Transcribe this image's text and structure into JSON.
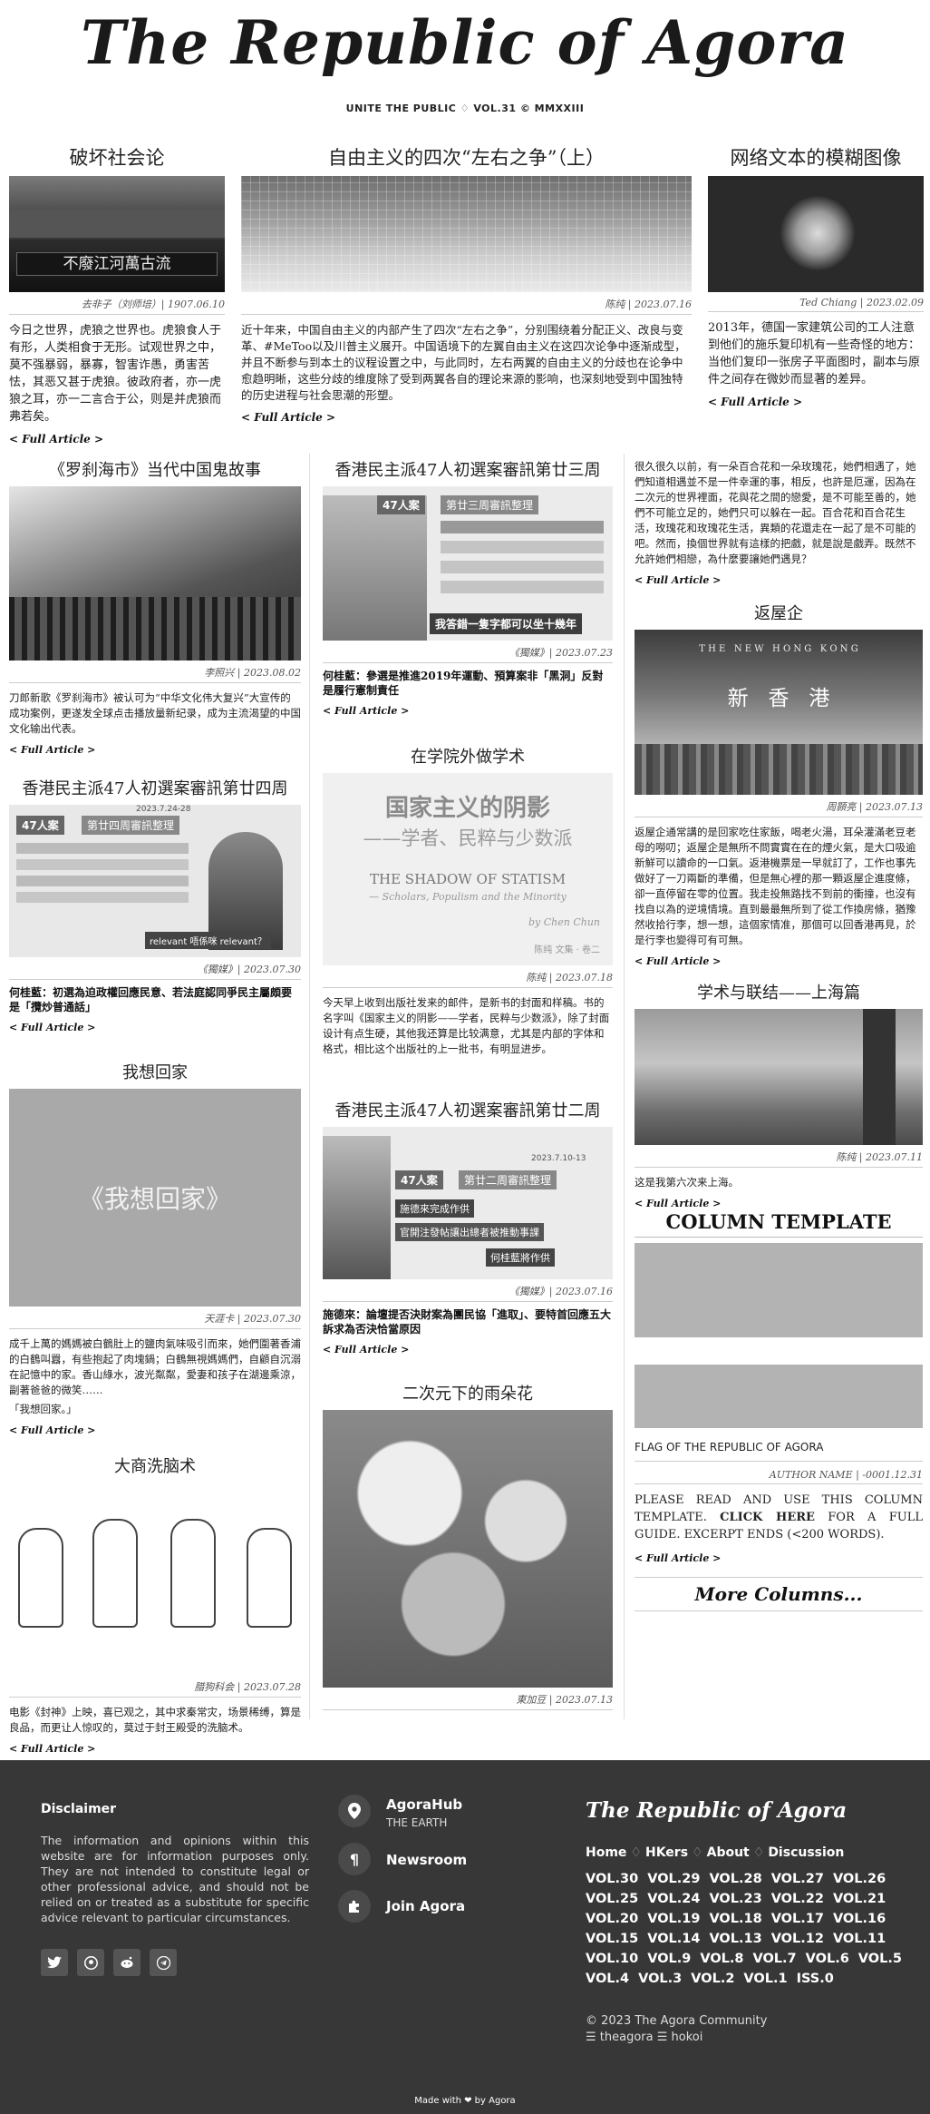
{
  "masthead": {
    "title": "The Republic of Agora",
    "subtitle": "UNITE THE PUBLIC ♢ VOL.31 © MMXXIII"
  },
  "more_label": "< Full Article >",
  "articles": {
    "a1": {
      "title": "破坏社会论",
      "img_caption": "不廢江河萬古流",
      "meta": "去非子（刘师培）| 1907.06.10",
      "excerpt": "今日之世界，虎狼之世界也。虎狼食人于有形，人类相食于无形。试观世界之中，莫不强暴弱，暴寡，智害诈愚，勇害苦怯，其恶又甚于虎狼。彼政府者，亦一虎狼之耳，亦一二言合于公，则是并虎狼而弗若矣。"
    },
    "a2": {
      "title": "自由主义的四次“左右之争”（上）",
      "meta": "陈纯 | 2023.07.16",
      "excerpt": "近十年来，中国自由主义的内部产生了四次“左右之争”，分别围绕着分配正义、改良与变革、#MeToo以及川普主义展开。中国语境下的左翼自由主义在这四次论争中逐渐成型，并且不断参与到本土的议程设置之中，与此同时，左右两翼的自由主义的分歧也在论争中愈趋明晰，这些分歧的维度除了受到两翼各自的理论来源的影响，也深刻地受到中国独特的历史进程与社会思潮的形塑。"
    },
    "a3": {
      "title": "网络文本的模糊图像",
      "meta": "Ted Chiang | 2023.02.09",
      "excerpt": "2013年，德国一家建筑公司的工人注意到他们的施乐复印机有一些奇怪的地方：当他们复印一张房子平面图时，副本与原件之间存在微妙而显著的差异。"
    },
    "a4": {
      "title": "《罗刹海市》当代中国鬼故事",
      "meta": "李照兴 | 2023.08.02",
      "excerpt": "刀郎新歌《罗刹海市》被认可为“中华文化伟大复兴”大宣传的成功案例，更遂发全球点击播放量新纪录，成为主流渴望的中国文化输出代表。"
    },
    "a5": {
      "title": "香港民主派47人初選案審訊第廿三周",
      "meta": "《獨媒》| 2023.07.23",
      "headline": "何桂藍：參選是推進2019年運動、預算案非「黑洞」反對是履行憲制責任",
      "img_tag": "47人案",
      "img_text": "第廿三周審訊整理",
      "img_banner": "我答錯一隻字都可以坐十幾年"
    },
    "a6": {
      "excerpt": "很久很久以前，有一朵百合花和一朵玫瑰花，她們相遇了，她們知道相遇並不是一件幸運的事，相反，也許是厄運，因為在二次元的世界裡面，花與花之間的戀愛，是不可能至善的，她們不可能立足的，她們只可以躲在一起。百合花和百合花生活，玫瑰花和玫瑰花生活，異類的花還走在一起了是不可能的吧。然而，換個世界就有這樣的把戲，就是說是戲弄。既然不允許她們相戀，為什麼要讓她們遇見？"
    },
    "a7": {
      "title": "返屋企",
      "meta": "周顥亮 | 2023.07.13",
      "img_top": "T H E   N E W   H O N G   K O N G",
      "img_main": "新   香   港",
      "excerpt": "返屋企通常講的是回家吃住家飯，喝老火湯，耳朵灌滿老豆老母的嘮叨；返屋企是無所不問實實在在的煙火氣，是大口吸逾新鮮可以讀命的一口氣。返港機票是一早就訂了，工作也事先做好了一刀兩斷的準備，但是無心裡的那一顆返屋企進度條，卻一直停留在零的位置。我走投無路找不到前的衝撞，也沒有找自以為的逆境情境。直到最最無所到了從工作換房條，猶豫然收拾行李，想一想，這個家情准，那個可以回香港再見，於是行李也變得可有可無。"
    },
    "a8": {
      "title": "在学院外做学术",
      "meta": "陈纯 | 2023.07.18",
      "cover_cn": "国家主义的阴影",
      "cover_cn_sub": "——学者、民粹与少数派",
      "cover_en": "THE SHADOW OF STATISM",
      "cover_en_sub": "— Scholars, Populism and the Minority",
      "cover_author": "by Chen Chun",
      "cover_author_cn": "陈纯 文集 · 卷二",
      "excerpt": "今天早上收到出版社发来的邮件，是新书的封面和样稿。书的名字叫《国家主义的阴影——学者，民粹与少数派》，除了封面设计有点生硬，其他我还算是比较满意，尤其是内部的字体和格式，相比这个出版社的上一批书，有明显进步。"
    },
    "a9": {
      "title": "香港民主派47人初選案審訊第廿四周",
      "meta": "《獨媒》| 2023.07.30",
      "headline": "何桂藍：初選為迫政權回應民意、若法庭認同爭民主屬頗要是「攬炒普通話」",
      "img_tag": "47人案",
      "img_text": "第廿四周審訊整理",
      "img_date": "2023.7.24-28",
      "img_banner": "relevant 唔係咪 relevant？"
    },
    "a10": {
      "title": "学术与联结——上海篇",
      "meta": "陈纯 | 2023.07.11",
      "excerpt": "这是我第六次来上海。"
    },
    "a11": {
      "title": "我想回家",
      "meta": "天涯卡 | 2023.07.30",
      "img_text": "《我想回家》",
      "excerpt": "成千上萬的媽媽被白鶴肚上的鹽肉氣味吸引而來，她們圍著香浦的白鶴叫囂，有些抱起了肉塊鍋；白鶴無視媽媽們，自顧自沉溺在記憶中的家。香山綠水，波光粼粼，愛妻和孩子在湖邊乘涼，副著爸爸的微笑……",
      "quote": "「我想回家。」"
    },
    "a12": {
      "title": "香港民主派47人初選案審訊第廿二周",
      "meta": "《獨媒》| 2023.07.16",
      "headline": "施德來：論壇提否決財案為團民協「進取」、要特首回應五大訴求為否決恰當原因",
      "img_tag": "47人案",
      "img_text": "第廿二周審訊整理",
      "img_date": "2023.7.10-13",
      "img_banner": "何桂藍將作供",
      "img_banner2": "官開注發帖讓出總者被推動事課",
      "img_banner3": "施德來完成作供"
    },
    "a13": {
      "title": "大商洗脑术",
      "meta": "腊狗科会 | 2023.07.28",
      "excerpt": "电影《封神》上映，喜已观之，其中求秦常灾，场景稀缚，算是良品，而更让人惊叹的，莫过于封王殿受的洗脑术。"
    },
    "a14": {
      "title": "二次元下的雨朵花",
      "meta": "東加豆 | 2023.07.13"
    }
  },
  "template": {
    "title": "COLUMN TEMPLATE",
    "caption": "FLAG OF THE REPUBLIC OF AGORA",
    "meta": "AUTHOR NAME | -0001.12.31",
    "excerpt_pre": "PLEASE READ AND USE THIS COLUMN TEMPLATE. ",
    "excerpt_link": "CLICK HERE",
    "excerpt_post": " FOR A FULL GUIDE. EXCERPT ENDS (<200 WORDS).",
    "more_columns": "More Columns..."
  },
  "footer": {
    "disclaimer_title": "Disclaimer",
    "disclaimer_text": "The information and opinions within this website are for information purposes only. They are not intended to constitute legal or other professional advice, and should not be relied on or treated as a substitute for specific advice relevant to particular circumstances.",
    "links": [
      {
        "label": "AgoraHub",
        "sub": "THE EARTH",
        "icon": "map-pin-icon"
      },
      {
        "label": "Newsroom",
        "sub": "",
        "icon": "pilcrow-icon"
      },
      {
        "label": "Join Agora",
        "sub": "",
        "icon": "puzzle-icon"
      }
    ],
    "brand": "The Republic of Agora",
    "nav": [
      "Home",
      "HKers",
      "About",
      "Discussion"
    ],
    "nav_sep": "♢",
    "volumes": [
      "VOL.30",
      "VOL.29",
      "VOL.28",
      "VOL.27",
      "VOL.26",
      "VOL.25",
      "VOL.24",
      "VOL.23",
      "VOL.22",
      "VOL.21",
      "VOL.20",
      "VOL.19",
      "VOL.18",
      "VOL.17",
      "VOL.16",
      "VOL.15",
      "VOL.14",
      "VOL.13",
      "VOL.12",
      "VOL.11",
      "VOL.10",
      "VOL.9",
      "VOL.8",
      "VOL.7",
      "VOL.6",
      "VOL.5",
      "VOL.4",
      "VOL.3",
      "VOL.2",
      "VOL.1",
      "ISS.0"
    ],
    "copyright": "© 2023 The Agora Community",
    "credits": "☰ theagora ☰ hokoi",
    "made_with": "Made with ❤ by Agora",
    "social_icons": [
      "twitter-icon",
      "github-icon",
      "reddit-icon",
      "telegram-icon"
    ]
  }
}
